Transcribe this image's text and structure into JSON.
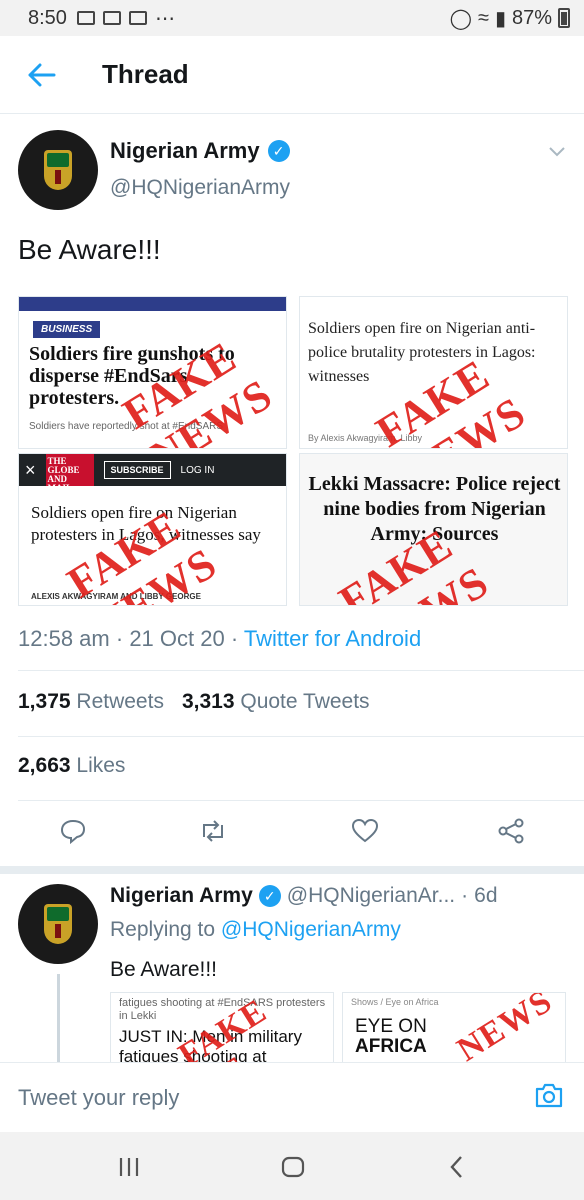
{
  "status_bar": {
    "time": "8:50",
    "more": "⋯",
    "battery": "87%"
  },
  "header": {
    "title": "Thread"
  },
  "tweet": {
    "display_name": "Nigerian Army",
    "handle": "@HQNigerianArmy",
    "text": "Be Aware!!!",
    "media": [
      {
        "badge": "BUSINESS",
        "headline": "Soldiers fire gunshots to disperse #EndSars protesters.",
        "sub": "Soldiers have reportedly shot at #EndSARS",
        "stamp": "FAKE NEWS"
      },
      {
        "headline": "Soldiers open fire on Nigerian anti-police brutality protesters in Lagos: witnesses",
        "byline": "By Alexis Akwagyiram, Libby",
        "stamp": "FAKE NEWS"
      },
      {
        "logo": "THE GLOBE AND MAIL",
        "subscribe": "SUBSCRIBE",
        "login": "LOG IN",
        "headline": "Soldiers open fire on Nigerian protesters in Lagos, witnesses say",
        "byline": "ALEXIS AKWAGYIRAM AND LIBBY GEORGE",
        "stamp": "FAKE NEWS"
      },
      {
        "headline": "Lekki Massacre: Police reject nine bodies from Nigerian Army: Sources",
        "stamp": "FAKE NEWS"
      }
    ],
    "time": "12:58 am",
    "date": "21 Oct 20",
    "source": "Twitter for Android",
    "retweets_count": "1,375",
    "retweets_label": "Retweets",
    "quotes_count": "3,313",
    "quotes_label": "Quote Tweets",
    "likes_count": "2,663",
    "likes_label": "Likes"
  },
  "reply": {
    "display_name": "Nigerian Army",
    "handle": "@HQNigerianAr...",
    "age": "6d",
    "replying_prefix": "Replying to",
    "replying_to": "@HQNigerianArmy",
    "text": "Be Aware!!!",
    "media": [
      {
        "top": "fatigues shooting at #EndSARS protesters in Lekki",
        "headline": "JUST IN: Men in military fatigues shooting at"
      },
      {
        "crumb": "Shows / Eye on Africa",
        "title_1": "EYE ON",
        "title_2": "AFRICA"
      }
    ]
  },
  "compose": {
    "placeholder": "Tweet your reply"
  },
  "colors": {
    "accent": "#1da1f2",
    "muted": "#657786",
    "stamp": "#e0201b"
  },
  "icons": [
    "back-arrow-icon",
    "verified-badge-icon",
    "chevron-down-icon",
    "reply-icon",
    "retweet-icon",
    "like-icon",
    "share-icon",
    "camera-icon",
    "recent-apps-icon",
    "home-icon",
    "back-nav-icon"
  ]
}
